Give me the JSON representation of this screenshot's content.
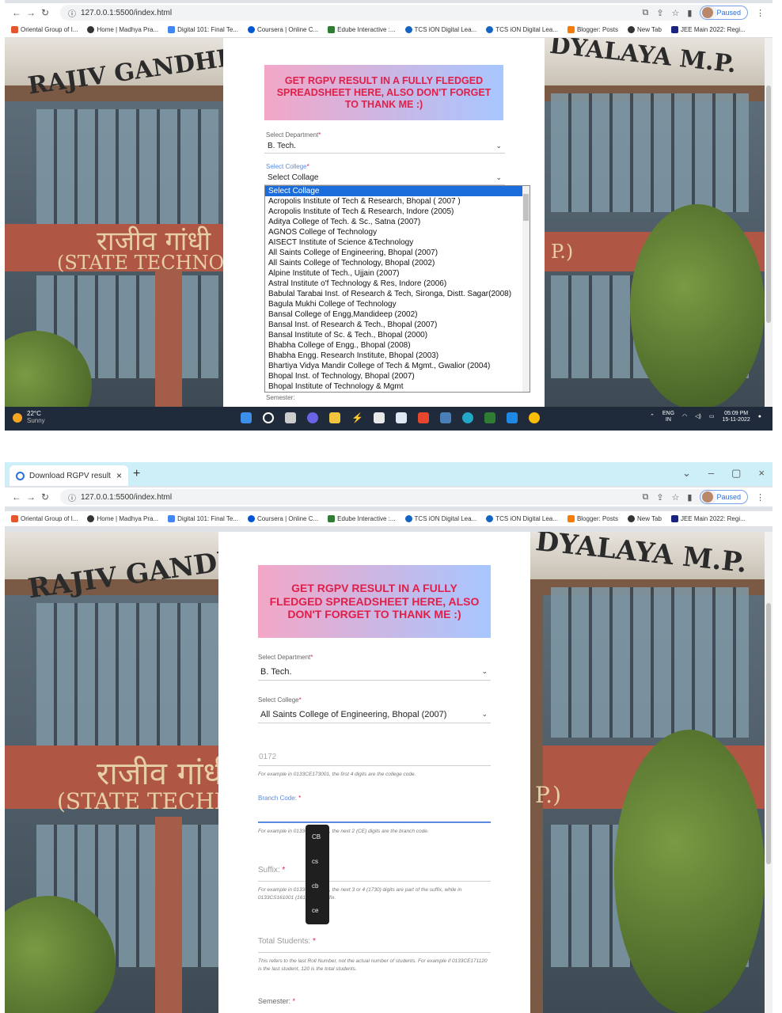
{
  "browser": {
    "url": "127.0.0.1:5500/index.html",
    "tab_title": "Download RGPV result",
    "profile_status": "Paused",
    "bookmarks": [
      "Oriental Group of I...",
      "Home | Madhya Pra...",
      "Digital 101: Final Te...",
      "Coursera | Online C...",
      "Edube Interactive :...",
      "TCS iON Digital Lea...",
      "TCS iON Digital Lea...",
      "Blogger: Posts",
      "New Tab",
      "JEE Main 2022: Regi..."
    ]
  },
  "background": {
    "sign_left": "RAJIV GANDHI PR",
    "sign_right": "DYALAYA M.P.",
    "hindi_sign": "राजीव गांधी",
    "sign_sub": "(STATE TECHNO",
    "sign_sub_right": "P.)"
  },
  "form": {
    "banner": "GET RGPV RESULT IN A FULLY FLEDGED SPREADSHEET HERE, ALSO DON'T FORGET TO THANK ME :)",
    "department_label": "Select Department",
    "department_value": "B. Tech.",
    "college_label": "Select College",
    "college_value_1": "Select Collage",
    "college_value_2": "All Saints College of Engineering, Bhopal (2007)",
    "college_code_placeholder": "0172",
    "college_code_hint": "For example in 0133CE173001, the first 4 digits are the college code.",
    "branch_label": "Branch Code:",
    "branch_hint": "For example in 0133CE173001, the next 2 (CE) digits are the branch code.",
    "suffix_label": "Suffix:",
    "suffix_hint": "For example in 0133CE173001, the next 3 or 4 (1730) digits are part of the suffix, while in 0133CS161001 (161) is the suffix.",
    "total_label": "Total Students:",
    "total_hint": "This refers to the last Roll Number, not the actual number of students. For example if 0133CE171120 is the last student, 120 is the total students.",
    "semester_label": "Semester:",
    "required_mark": "*"
  },
  "college_options": [
    "Select Collage",
    "Acropolis Institute of Tech & Research, Bhopal ( 2007 )",
    "Acropolis Institute of Tech & Research, Indore (2005)",
    "Aditya College of Tech. & Sc., Satna (2007)",
    "AGNOS College of Technology",
    "AISECT Institute of Science &Technology",
    "All Saints College of Engineering, Bhopal (2007)",
    "All Saints College of Technology, Bhopal (2002)",
    "Alpine Institute of Tech., Ujjain (2007)",
    "Astral Institute o'f Technology & Res, Indore (2006)",
    "Babulal Tarabai Inst. of Research & Tech, Sironga, Distt. Sagar(2008)",
    "Bagula Mukhi College of Technology",
    "Bansal College of Engg,Mandideep (2002)",
    "Bansal Inst. of Research & Tech., Bhopal (2007)",
    "Bansal Institute of Sc. & Tech., Bhopal (2000)",
    "Bhabha College of Engg., Bhopal (2008)",
    "Bhabha Engg. Research Institute, Bhopal (2003)",
    "Bhartiya Vidya Mandir College of Tech & Mgmt., Gwalior (2004)",
    "Bhopal Inst. of Technology, Bhopal (2007)",
    "Bhopal Institute of Technology & Mgmt"
  ],
  "branch_suggestions": [
    "CB",
    "cs",
    "cb",
    "ce"
  ],
  "taskbar": {
    "temp": "22°C",
    "weather": "Sunny",
    "lang": "ENG",
    "region": "IN",
    "time": "05:09 PM",
    "date": "15-11-2022"
  },
  "colors": {
    "banner_text": "#e0204a",
    "banner_gradient_start": "#f3a7c7",
    "banner_gradient_end": "#a7c6ff",
    "selected_option": "#1a6ddb"
  }
}
